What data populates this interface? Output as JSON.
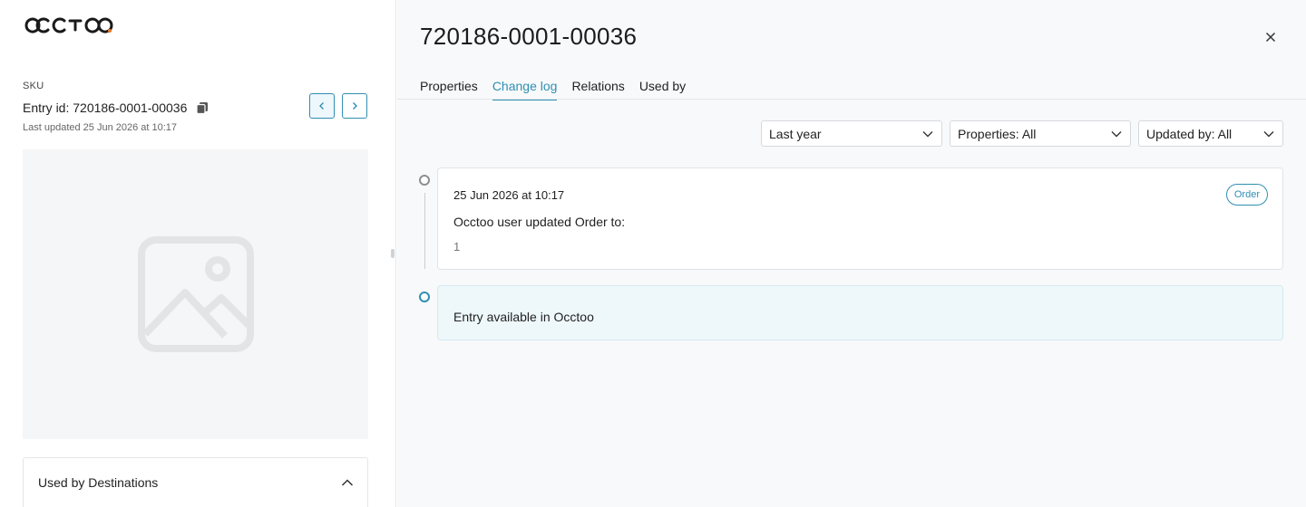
{
  "app": {
    "logo_text": "occtoo"
  },
  "entry": {
    "type_label": "SKU",
    "id_text": "Entry id: 720186-0001-00036",
    "last_updated": "Last updated 25 Jun 2026 at 10:17"
  },
  "destinations": {
    "title": "Used by Destinations"
  },
  "detail": {
    "title": "720186-0001-00036",
    "tabs": [
      {
        "label": "Properties"
      },
      {
        "label": "Change log"
      },
      {
        "label": "Relations"
      },
      {
        "label": "Used by"
      }
    ],
    "active_tab": "Change log"
  },
  "filters": {
    "period": "Last year",
    "properties": "Properties: All",
    "updated_by": "Updated by: All"
  },
  "changelog": [
    {
      "date": "25 Jun 2026 at 10:17",
      "message": "Occtoo user updated Order to:",
      "value": "1",
      "badge": "Order"
    },
    {
      "message": "Entry available in Occtoo"
    }
  ],
  "colors": {
    "accent": "#2f8fb3",
    "panel_bg": "#f8f9fa",
    "highlight_bg": "#eef8fb"
  }
}
